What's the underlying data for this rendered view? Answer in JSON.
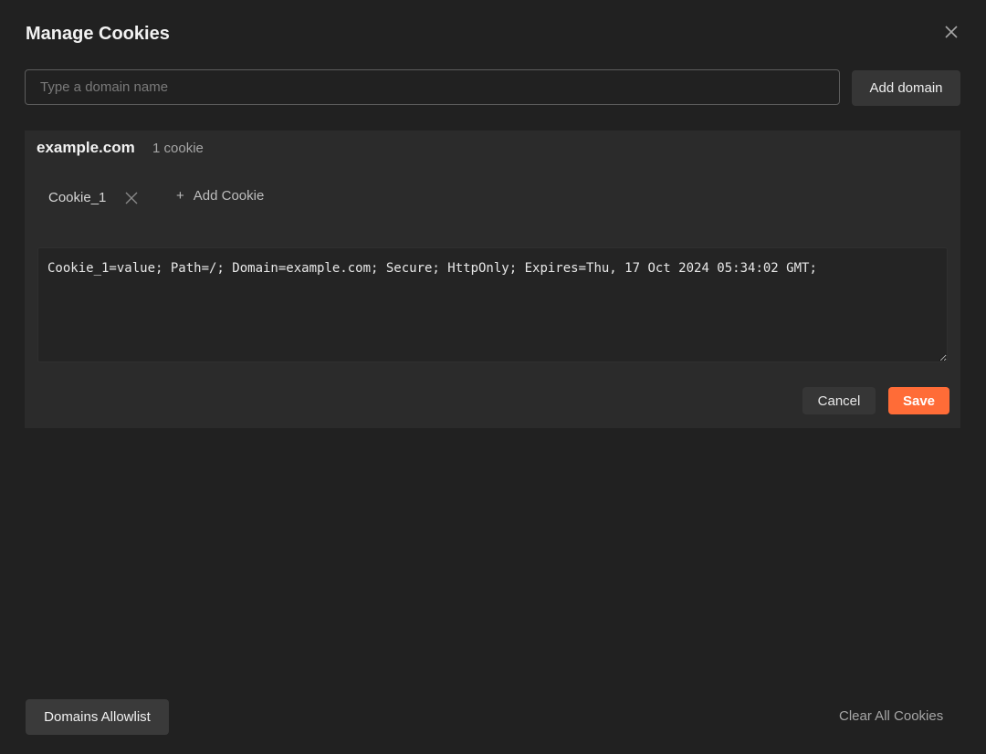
{
  "modal": {
    "title": "Manage Cookies",
    "close_icon": "close-icon"
  },
  "domain_input": {
    "placeholder": "Type a domain name",
    "value": ""
  },
  "add_domain_label": "Add domain",
  "domains": [
    {
      "name": "example.com",
      "cookie_count": "1 cookie",
      "cookies": [
        {
          "name": "Cookie_1",
          "close_icon": "close-icon"
        }
      ],
      "add_cookie_label": "Add Cookie",
      "add_cookie_icon": "plus-icon",
      "editor_value": "Cookie_1=value; Path=/; Domain=example.com; Secure; HttpOnly; Expires=Thu, 17 Oct 2024 05:34:02 GMT;",
      "cancel_label": "Cancel",
      "save_label": "Save"
    }
  ],
  "footer": {
    "allowlist_label": "Domains Allowlist",
    "clear_all_label": "Clear All Cookies"
  },
  "colors": {
    "background": "#212121",
    "panel": "#2b2b2b",
    "accent": "#ff6c37"
  }
}
